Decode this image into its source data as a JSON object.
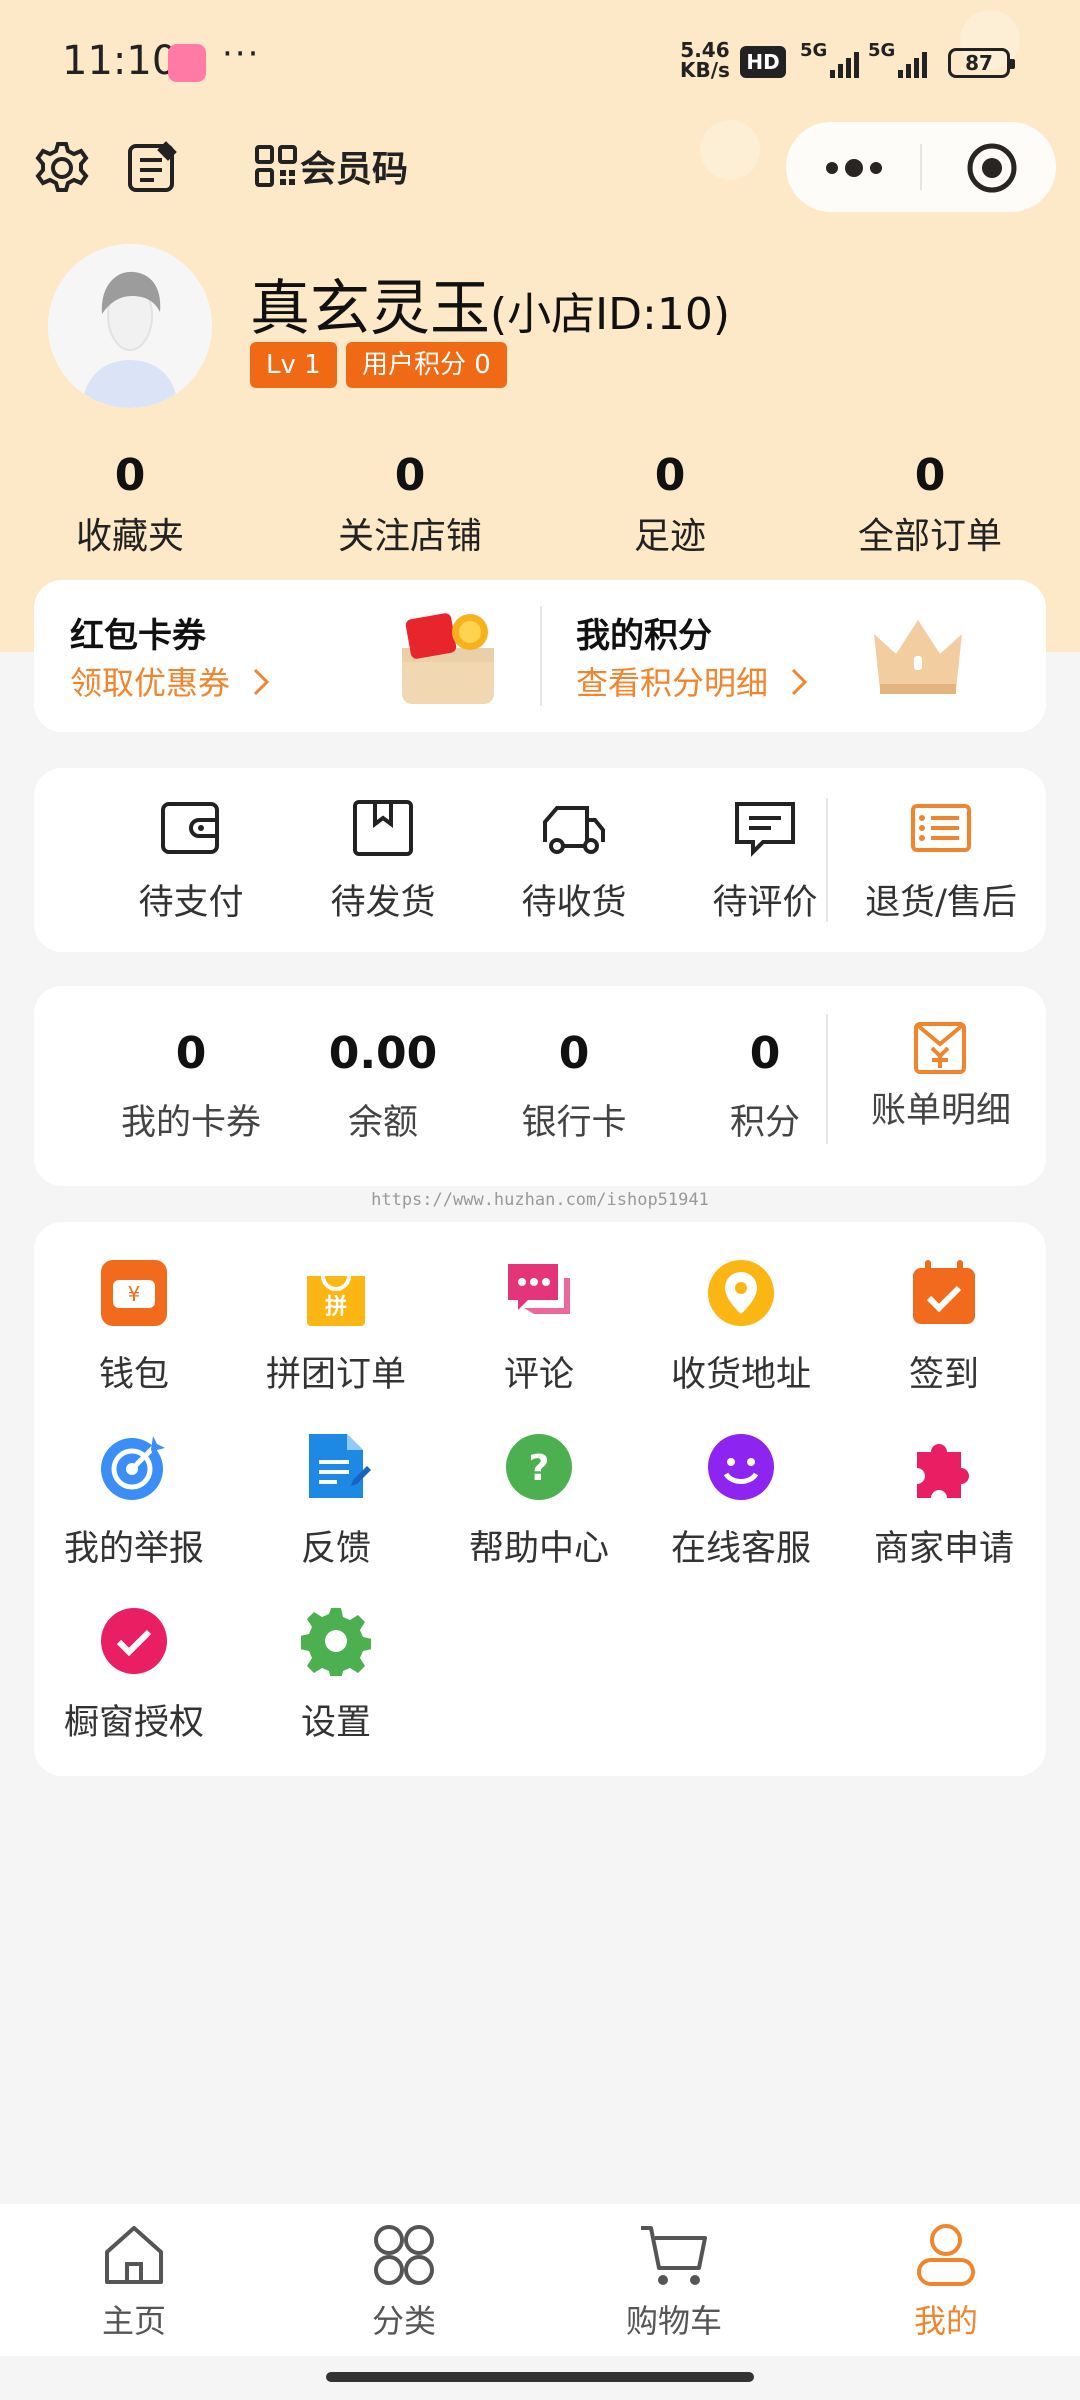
{
  "status_bar": {
    "time": "11:10",
    "app_icon": "bilibili-app-icon",
    "more": "···",
    "net_speed_value": "5.46",
    "net_speed_unit": "KB/s",
    "hd_label": "HD",
    "signal1_label": "5G",
    "signal2_label": "5G",
    "battery": "87"
  },
  "top_bar": {
    "member_code_label": "会员码"
  },
  "profile": {
    "nickname": "真玄灵玉",
    "shop_id": "(小店ID:10)",
    "level_badge": "Lv 1",
    "points_badge": "用户积分 0"
  },
  "stats": [
    {
      "value": "0",
      "label": "收藏夹"
    },
    {
      "value": "0",
      "label": "关注店铺"
    },
    {
      "value": "0",
      "label": "足迹"
    },
    {
      "value": "0",
      "label": "全部订单"
    }
  ],
  "promo": {
    "coupon_title": "红包卡券",
    "coupon_link": "领取优惠券",
    "points_title": "我的积分",
    "points_link": "查看积分明细"
  },
  "orders": [
    {
      "label": "待支付",
      "icon": "wallet-icon"
    },
    {
      "label": "待发货",
      "icon": "box-icon"
    },
    {
      "label": "待收货",
      "icon": "truck-icon"
    },
    {
      "label": "待评价",
      "icon": "comment-icon"
    },
    {
      "label": "退货/售后",
      "icon": "list-icon"
    }
  ],
  "assets": [
    {
      "value": "0",
      "label": "我的卡券"
    },
    {
      "value": "0.00",
      "label": "余额"
    },
    {
      "value": "0",
      "label": "银行卡"
    },
    {
      "value": "0",
      "label": "积分"
    }
  ],
  "bill": {
    "label": "账单明细",
    "icon": "bill-icon"
  },
  "watermark": "https://www.huzhan.com/ishop51941",
  "services": [
    {
      "label": "钱包",
      "icon": "wallet-icon"
    },
    {
      "label": "拼团订单",
      "icon": "group-buy-icon"
    },
    {
      "label": "评论",
      "icon": "comment-icon"
    },
    {
      "label": "收货地址",
      "icon": "location-icon"
    },
    {
      "label": "签到",
      "icon": "calendar-check-icon"
    },
    {
      "label": "我的举报",
      "icon": "target-icon"
    },
    {
      "label": "反馈",
      "icon": "feedback-icon"
    },
    {
      "label": "帮助中心",
      "icon": "help-icon"
    },
    {
      "label": "在线客服",
      "icon": "customer-service-icon"
    },
    {
      "label": "商家申请",
      "icon": "puzzle-icon"
    },
    {
      "label": "橱窗授权",
      "icon": "check-circle-icon"
    },
    {
      "label": "设置",
      "icon": "gear-icon"
    }
  ],
  "tabs": [
    {
      "label": "主页",
      "icon": "home-icon"
    },
    {
      "label": "分类",
      "icon": "category-icon"
    },
    {
      "label": "购物车",
      "icon": "cart-icon"
    },
    {
      "label": "我的",
      "icon": "user-icon",
      "active": true
    }
  ],
  "colors": {
    "accent": "#f0852d",
    "badge": "#f06a16",
    "header_bg": "#fde8c8"
  }
}
